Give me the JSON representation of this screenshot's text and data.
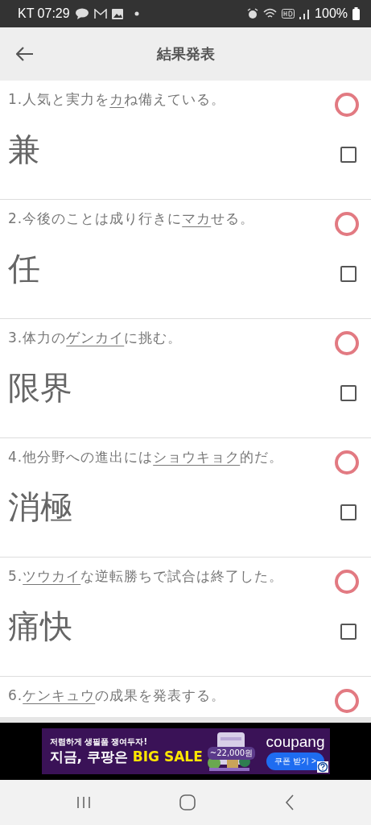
{
  "status_bar": {
    "carrier_time": "KT 07:29",
    "battery": "100%"
  },
  "header": {
    "title": "結果発表"
  },
  "questions": [
    {
      "prefix": "1.人気と実力を",
      "underlined": "カ",
      "suffix": "ね備えている。",
      "correct": true,
      "answer": "兼",
      "checked": false
    },
    {
      "prefix": "2.今後のことは成り行きに",
      "underlined": "マカ",
      "suffix": "せる。",
      "correct": true,
      "answer": "任",
      "checked": false
    },
    {
      "prefix": "3.体力の",
      "underlined": "ゲンカイ",
      "suffix": "に挑む。",
      "correct": true,
      "answer": "限界",
      "checked": false
    },
    {
      "prefix": "4.他分野への進出には",
      "underlined": "ショウキョク",
      "suffix": "的だ。",
      "correct": true,
      "answer": "消極",
      "checked": false
    },
    {
      "prefix": "5.",
      "underlined": "ツウカイ",
      "suffix": "な逆転勝ちで試合は終了した。",
      "correct": true,
      "answer": "痛快",
      "checked": false
    },
    {
      "prefix": "6.",
      "underlined": "ケンキュウ",
      "suffix": "の成果を発表する。",
      "correct": true
    }
  ],
  "ad": {
    "tagline": "저렴하게 생필품 쟁여두자!",
    "headline": "지금, 쿠팡은",
    "sale": "BIG SALE",
    "price": "~22,000원",
    "brand": "coupang",
    "button": "쿠폰 받기 >"
  }
}
